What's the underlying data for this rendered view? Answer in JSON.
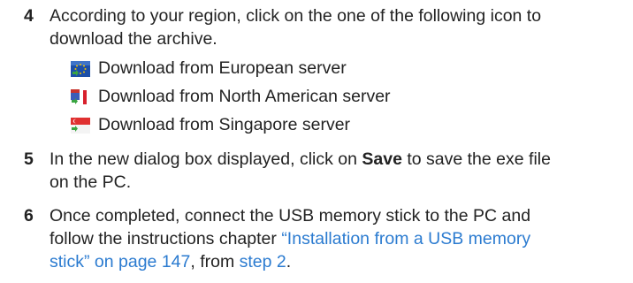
{
  "steps": [
    {
      "number": "4",
      "line1": "According to your region, click on the one of the following icon to",
      "line2": "download the archive."
    },
    {
      "number": "5",
      "text_before": "In the new dialog box displayed, click on ",
      "bold": "Save",
      "text_after": " to save the exe file",
      "line2": "on the PC."
    },
    {
      "number": "6",
      "line1": "Once completed, connect the USB memory stick to the PC and",
      "line2_before": "follow the instructions chapter ",
      "link_chapter_part1": "“Installation from a USB memory",
      "link_chapter_part2": "stick” on page 147",
      "line3_middle": ", from ",
      "link_step": "step 2",
      "line3_end": "."
    }
  ],
  "servers": [
    {
      "label": "Download from European server",
      "icon": "european-server-icon"
    },
    {
      "label": "Download from North American server",
      "icon": "north-american-server-icon"
    },
    {
      "label": "Download from Singapore server",
      "icon": "singapore-server-icon"
    }
  ],
  "colors": {
    "text": "#222222",
    "link": "#2b7bd0",
    "eu_flag": "#1c4fa8",
    "eu_stars": "#f2c200",
    "ca_red": "#d8202c",
    "sg_red": "#e03030",
    "arrow_green": "#3aa541"
  }
}
